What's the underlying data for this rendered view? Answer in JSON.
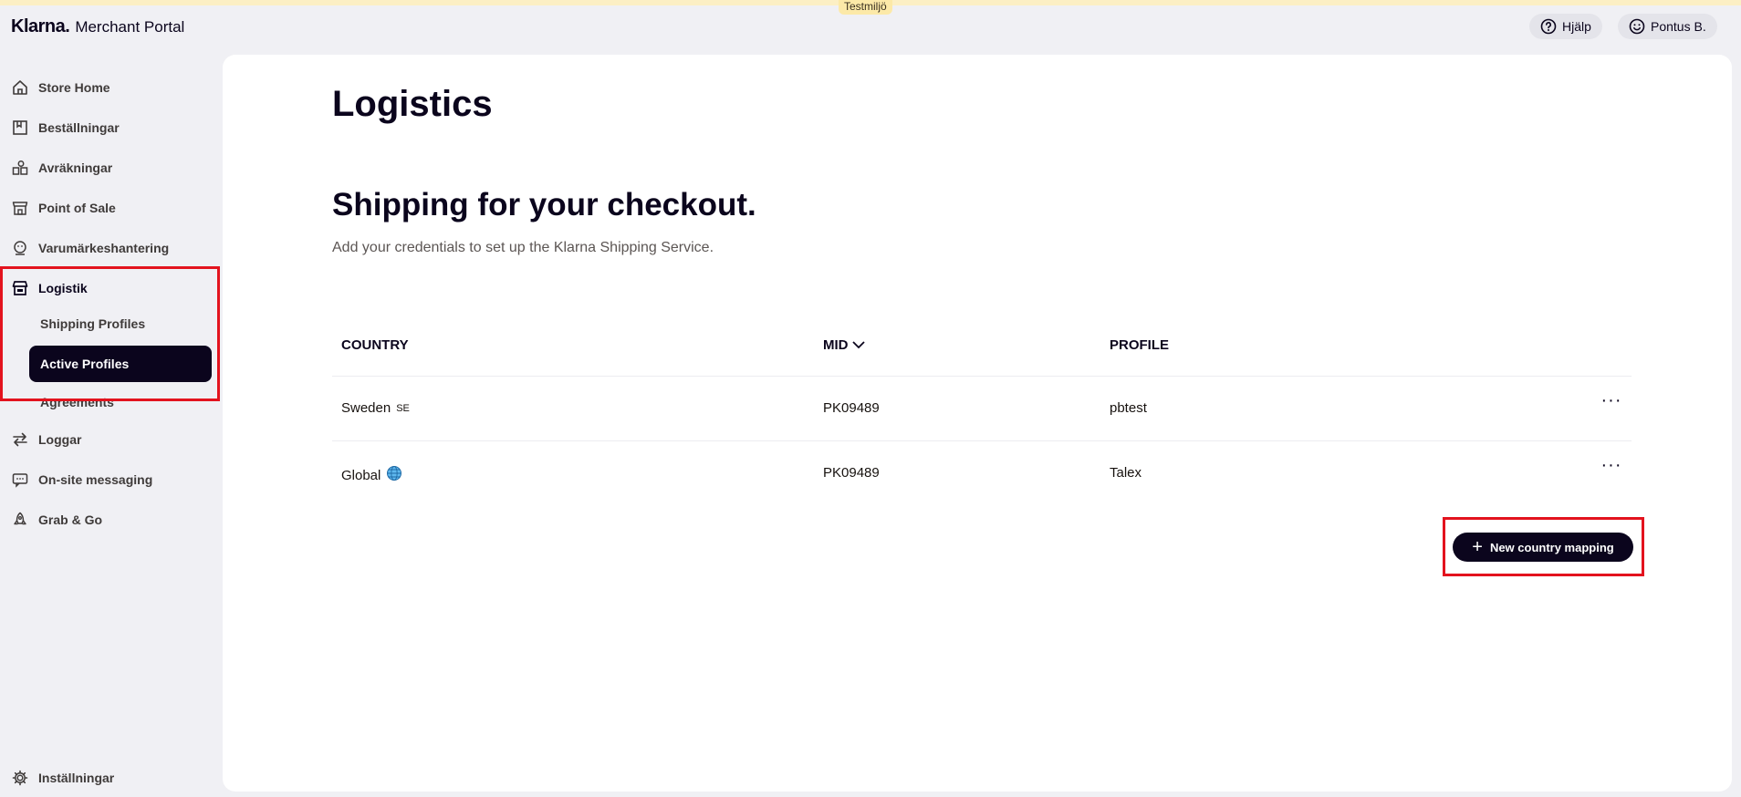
{
  "environment_badge": "Testmiljö",
  "header": {
    "brand_logo": "Klarna.",
    "brand_sub": "Merchant Portal",
    "help_label": "Hjälp",
    "user_label": "Pontus B."
  },
  "sidebar": {
    "items": [
      {
        "label": "Store Home",
        "icon": "home-icon"
      },
      {
        "label": "Beställningar",
        "icon": "orders-icon"
      },
      {
        "label": "Avräkningar",
        "icon": "settlements-icon"
      },
      {
        "label": "Point of Sale",
        "icon": "store-icon"
      },
      {
        "label": "Varumärkeshantering",
        "icon": "brand-icon"
      },
      {
        "label": "Logistik",
        "icon": "logistics-icon"
      },
      {
        "label": "Loggar",
        "icon": "swap-arrows-icon"
      },
      {
        "label": "On-site messaging",
        "icon": "chat-icon"
      },
      {
        "label": "Grab & Go",
        "icon": "rocket-icon"
      }
    ],
    "logistics_sub": [
      "Shipping Profiles",
      "Active Profiles",
      "Agreements"
    ],
    "settings_label": "Inställningar"
  },
  "main": {
    "page_title": "Logistics",
    "section_title": "Shipping for your checkout.",
    "section_desc": "Add your credentials to set up the Klarna Shipping Service.",
    "columns": [
      "COUNTRY",
      "MID",
      "PROFILE"
    ],
    "rows": [
      {
        "country": "Sweden",
        "country_code": "SE",
        "mid": "PK09489",
        "profile": "pbtest"
      },
      {
        "country": "Global",
        "country_code": "",
        "mid": "PK09489",
        "profile": "Talex"
      }
    ],
    "more_label": "···",
    "new_mapping_label": "New country mapping"
  },
  "colors": {
    "accent": "#0b051d",
    "highlight": "#e3131e",
    "env_strip": "#fcefc4"
  }
}
